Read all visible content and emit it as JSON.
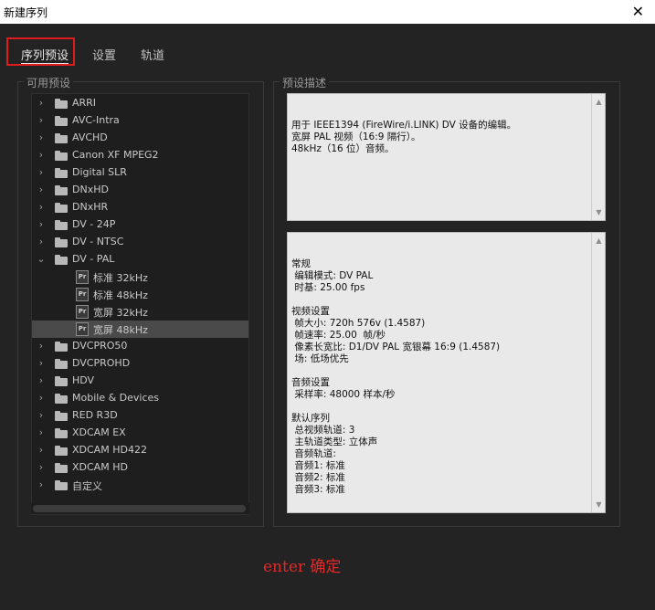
{
  "window": {
    "title": "新建序列",
    "close_label": "✕"
  },
  "tabs": [
    {
      "label": "序列预设",
      "active": true
    },
    {
      "label": "设置",
      "active": false
    },
    {
      "label": "轨道",
      "active": false
    }
  ],
  "presets_panel": {
    "label": "可用预设",
    "items": [
      {
        "label": "ARRI",
        "type": "folder",
        "expanded": false
      },
      {
        "label": "AVC-Intra",
        "type": "folder",
        "expanded": false
      },
      {
        "label": "AVCHD",
        "type": "folder",
        "expanded": false
      },
      {
        "label": "Canon XF MPEG2",
        "type": "folder",
        "expanded": false
      },
      {
        "label": "Digital SLR",
        "type": "folder",
        "expanded": false
      },
      {
        "label": "DNxHD",
        "type": "folder",
        "expanded": false
      },
      {
        "label": "DNxHR",
        "type": "folder",
        "expanded": false
      },
      {
        "label": "DV - 24P",
        "type": "folder",
        "expanded": false
      },
      {
        "label": "DV - NTSC",
        "type": "folder",
        "expanded": false
      },
      {
        "label": "DV - PAL",
        "type": "folder",
        "expanded": true
      },
      {
        "label": "标准 32kHz",
        "type": "preset",
        "badge": "Pr"
      },
      {
        "label": "标准 48kHz",
        "type": "preset",
        "badge": "Pr"
      },
      {
        "label": "宽屏 32kHz",
        "type": "preset",
        "badge": "Pr"
      },
      {
        "label": "宽屏 48kHz",
        "type": "preset",
        "badge": "Pr",
        "selected": true
      },
      {
        "label": "DVCPRO50",
        "type": "folder",
        "expanded": false
      },
      {
        "label": "DVCPROHD",
        "type": "folder",
        "expanded": false
      },
      {
        "label": "HDV",
        "type": "folder",
        "expanded": false
      },
      {
        "label": "Mobile & Devices",
        "type": "folder",
        "expanded": false
      },
      {
        "label": "RED R3D",
        "type": "folder",
        "expanded": false
      },
      {
        "label": "XDCAM EX",
        "type": "folder",
        "expanded": false
      },
      {
        "label": "XDCAM HD422",
        "type": "folder",
        "expanded": false
      },
      {
        "label": "XDCAM HD",
        "type": "folder",
        "expanded": false
      },
      {
        "label": "自定义",
        "type": "folder",
        "expanded": false
      }
    ]
  },
  "description_panel": {
    "label": "预设描述",
    "description_text": "用于 IEEE1394 (FireWire/i.LINK) DV 设备的编辑。\n宽屏 PAL 视频（16:9 隔行）。\n48kHz（16 位）音频。",
    "details_text": "常规\n 编辑模式: DV PAL\n 时基: 25.00 fps\n\n视频设置\n 帧大小: 720h 576v (1.4587)\n 帧速率: 25.00  帧/秒\n 像素长宽比: D1/DV PAL 宽银幕 16:9 (1.4587)\n 场: 低场优先\n\n音频设置\n 采样率: 48000 样本/秒\n\n默认序列\n 总视频轨道: 3\n 主轨道类型: 立体声\n 音频轨道:\n 音频1: 标准\n 音频2: 标准\n 音频3: 标准"
  },
  "annotation": {
    "text": "enter 确定",
    "color": "#e02a2a"
  },
  "colors": {
    "background": "#232323",
    "highlight": "#e01b1b",
    "selected_row": "#4a4a4a"
  }
}
